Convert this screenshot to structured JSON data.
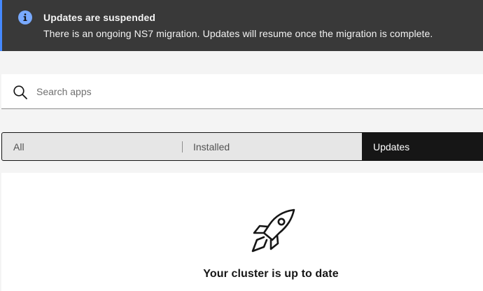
{
  "notification": {
    "title": "Updates are suspended",
    "subtitle": "There is an ongoing NS7 migration. Updates will resume once the migration is complete.",
    "icon": "info-icon",
    "accent_color": "#4589ff"
  },
  "search": {
    "placeholder": "Search apps",
    "value": "",
    "icon": "search-icon"
  },
  "switcher": {
    "tabs": [
      {
        "label": "All",
        "selected": false
      },
      {
        "label": "Installed",
        "selected": false
      },
      {
        "label": "Updates",
        "selected": true
      }
    ]
  },
  "empty_state": {
    "icon": "rocket-icon",
    "title": "Your cluster is up to date"
  }
}
